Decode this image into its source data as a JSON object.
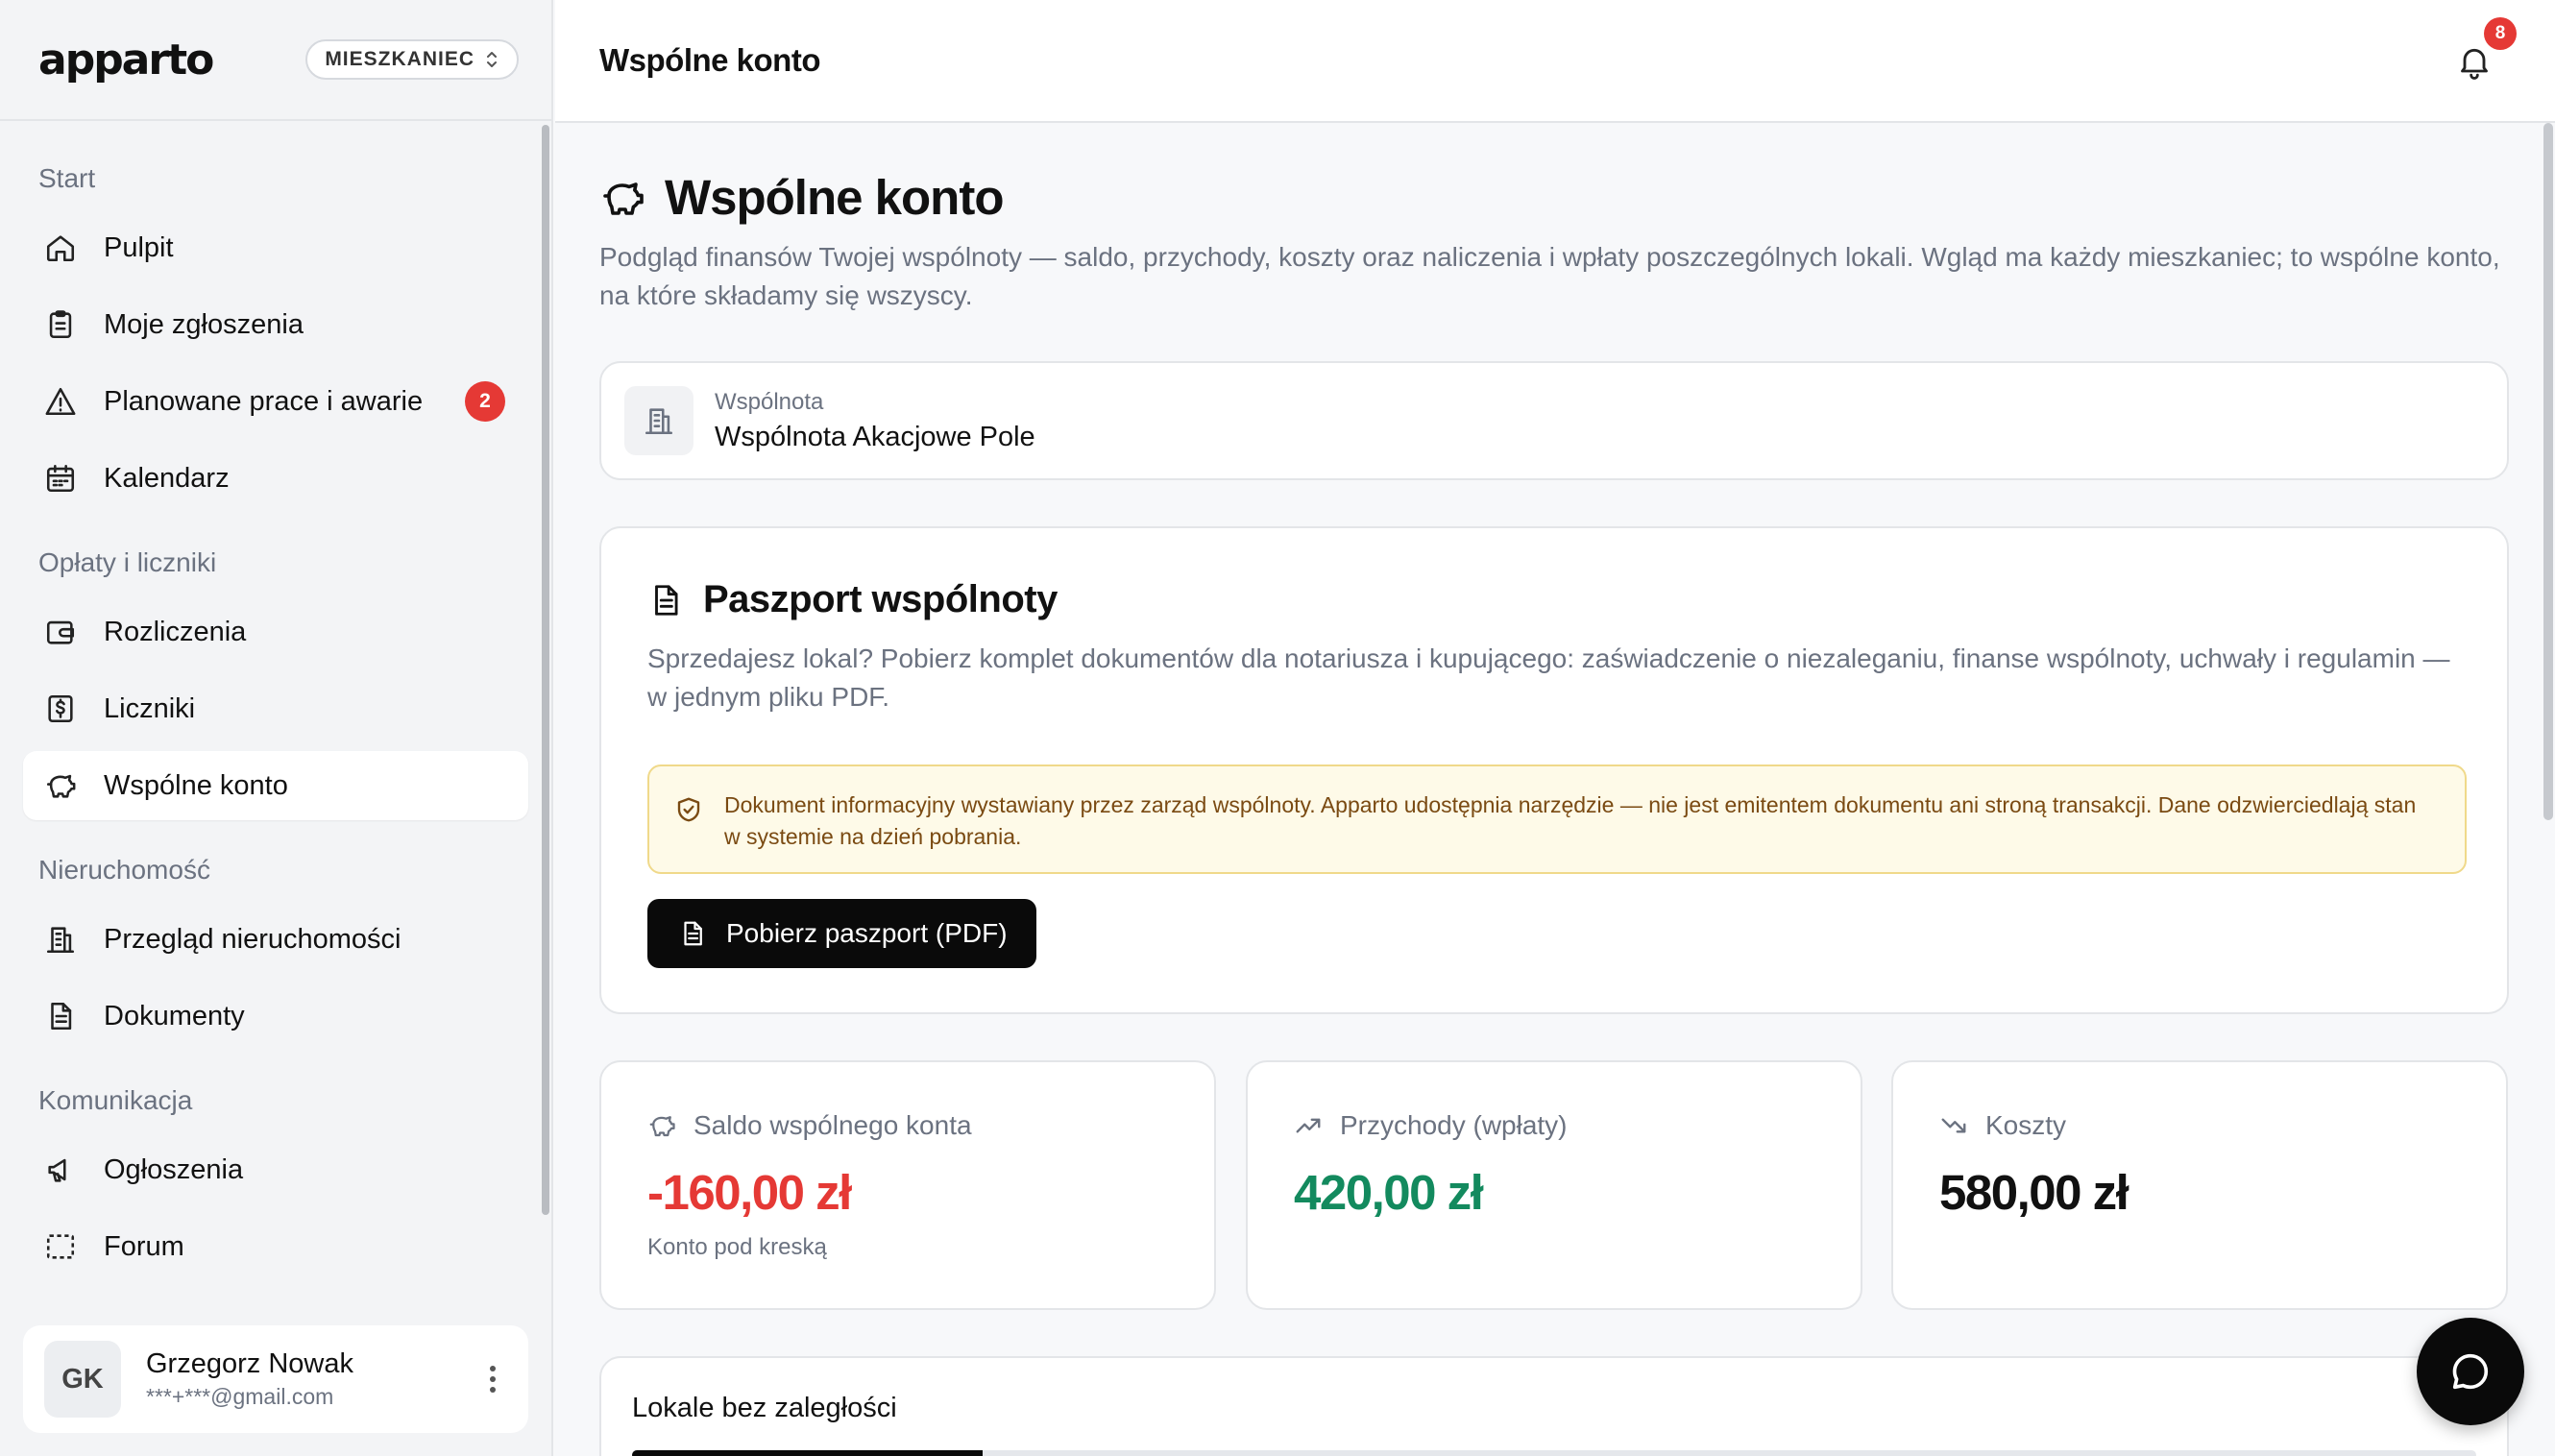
{
  "app": {
    "logo_text": "apparto",
    "role_label": "MIESZKANIEC"
  },
  "sidebar": {
    "sections": [
      {
        "title": "Start",
        "items": [
          {
            "label": "Pulpit",
            "icon": "home-icon"
          },
          {
            "label": "Moje zgłoszenia",
            "icon": "clipboard-icon"
          },
          {
            "label": "Planowane prace i awarie",
            "icon": "warning-icon",
            "badge": "2"
          },
          {
            "label": "Kalendarz",
            "icon": "calendar-icon"
          }
        ]
      },
      {
        "title": "Opłaty i liczniki",
        "items": [
          {
            "label": "Rozliczenia",
            "icon": "wallet-icon"
          },
          {
            "label": "Liczniki",
            "icon": "receipt-icon"
          },
          {
            "label": "Wspólne konto",
            "icon": "piggy-bank-icon",
            "active": true
          }
        ]
      },
      {
        "title": "Nieruchomość",
        "items": [
          {
            "label": "Przegląd nieruchomości",
            "icon": "building-icon"
          },
          {
            "label": "Dokumenty",
            "icon": "document-icon"
          }
        ]
      },
      {
        "title": "Komunikacja",
        "items": [
          {
            "label": "Ogłoszenia",
            "icon": "megaphone-icon"
          },
          {
            "label": "Forum",
            "icon": "forum-icon"
          }
        ]
      }
    ]
  },
  "user": {
    "initials": "GK",
    "name": "Grzegorz Nowak",
    "email": "***+***@gmail.com"
  },
  "header": {
    "title": "Wspólne konto",
    "notifications_count": "8"
  },
  "main": {
    "title": "Wspólne konto",
    "description": "Podgląd finansów Twojej wspólnoty — saldo, przychody, koszty oraz naliczenia i wpłaty poszczególnych lokali. Wgląd ma każdy mieszkaniec; to wspólne konto, na które składamy się wszyscy.",
    "community": {
      "label": "Wspólnota",
      "value": "Wspólnota Akacjowe Pole"
    },
    "passport": {
      "title": "Paszport wspólnoty",
      "description": "Sprzedajesz lokal? Pobierz komplet dokumentów dla notariusza i kupującego: zaświadczenie o niezaleganiu, finanse wspólnoty, uchwały i regulamin — w jednym pliku PDF.",
      "notice": "Dokument informacyjny wystawiany przez zarząd wspólnoty. Apparto udostępnia narzędzie — nie jest emitentem dokumentu ani stroną transakcji. Dane odzwierciedlają stan w systemie na dzień pobrania.",
      "button_label": "Pobierz paszport (PDF)"
    },
    "stats": {
      "balance": {
        "label": "Saldo wspólnego konta",
        "value": "-160,00 zł",
        "sub": "Konto pod kreską",
        "color": "#e53935"
      },
      "income": {
        "label": "Przychody (wpłaty)",
        "value": "420,00 zł",
        "color": "#138a5e"
      },
      "costs": {
        "label": "Koszty",
        "value": "580,00 zł",
        "color": "#111111"
      }
    },
    "arrears": {
      "title": "Lokale bez zaległości",
      "progress_fraction": 0.19
    }
  }
}
